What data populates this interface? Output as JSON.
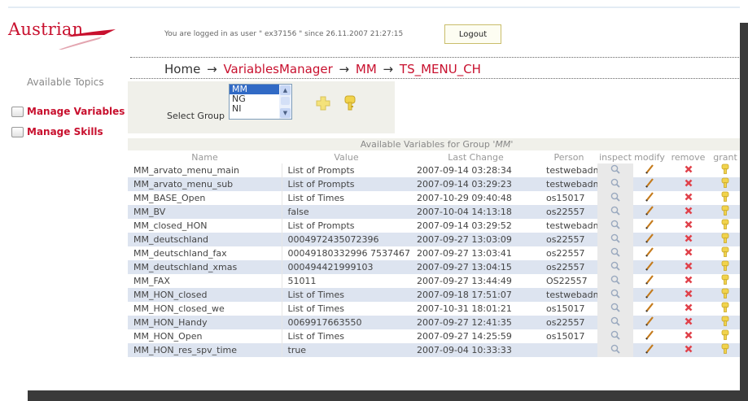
{
  "brand": {
    "name": "Austrian"
  },
  "header": {
    "login_info": "You are logged in as user \" ex37156 \" since 26.11.2007 21:27:15",
    "logout_label": "Logout"
  },
  "sidebar": {
    "title": "Available Topics",
    "items": [
      {
        "label": "Manage Variables"
      },
      {
        "label": "Manage Skills"
      }
    ]
  },
  "breadcrumb": {
    "items": [
      "Home",
      "VariablesManager",
      "MM",
      "TS_MENU_CH"
    ],
    "separator": "→"
  },
  "group": {
    "label": "Select Group",
    "options": [
      "MM",
      "NG",
      "NI"
    ],
    "selected": "MM"
  },
  "table": {
    "caption_prefix": "Available Variables for Group ",
    "caption_group": "'MM'",
    "columns": [
      "Name",
      "Value",
      "Last Change",
      "Person",
      "inspect",
      "modify",
      "remove",
      "grant"
    ],
    "rows": [
      {
        "name": "MM_arvato_menu_main",
        "value": "List of Prompts",
        "last_change": "2007-09-14 03:28:34",
        "person": "testwebadmin"
      },
      {
        "name": "MM_arvato_menu_sub",
        "value": "List of Prompts",
        "last_change": "2007-09-14 03:29:23",
        "person": "testwebadmin"
      },
      {
        "name": "MM_BASE_Open",
        "value": "List of Times",
        "last_change": "2007-10-29 09:40:48",
        "person": "os15017"
      },
      {
        "name": "MM_BV",
        "value": "false",
        "last_change": "2007-10-04 14:13:18",
        "person": "os22557"
      },
      {
        "name": "MM_closed_HON",
        "value": "List of Prompts",
        "last_change": "2007-09-14 03:29:52",
        "person": "testwebadmin"
      },
      {
        "name": "MM_deutschland",
        "value": "0004972435072396",
        "last_change": "2007-09-27 13:03:09",
        "person": "os22557"
      },
      {
        "name": "MM_deutschland_fax",
        "value": "00049180332996 7537467",
        "last_change": "2007-09-27 13:03:41",
        "person": "os22557"
      },
      {
        "name": "MM_deutschland_xmas",
        "value": "000494421999103",
        "last_change": "2007-09-27 13:04:15",
        "person": "os22557"
      },
      {
        "name": "MM_FAX",
        "value": "51011",
        "last_change": "2007-09-27 13:44:49",
        "person": "OS22557"
      },
      {
        "name": "MM_HON_closed",
        "value": "List of Times",
        "last_change": "2007-09-18 17:51:07",
        "person": "testwebadmin"
      },
      {
        "name": "MM_HON_closed_we",
        "value": "List of Times",
        "last_change": "2007-10-31 18:01:21",
        "person": "os15017"
      },
      {
        "name": "MM_HON_Handy",
        "value": "0069917663550",
        "last_change": "2007-09-27 12:41:35",
        "person": "os22557"
      },
      {
        "name": "MM_HON_Open",
        "value": "List of Times",
        "last_change": "2007-09-27 14:25:59",
        "person": "os15017"
      },
      {
        "name": "MM_HON_res_spv_time",
        "value": "true",
        "last_change": "2007-09-04 10:33:33",
        "person": ""
      }
    ]
  },
  "colors": {
    "brand_red": "#c8102e",
    "row_alt": "#dde4f0",
    "panel": "#f0f0ea",
    "frame_dark": "#3a3a3a"
  },
  "icons": {
    "inspect": "magnifier-icon",
    "modify": "pencil-icon",
    "remove": "red-x-icon",
    "grant": "key-icon",
    "add": "plus-icon"
  }
}
